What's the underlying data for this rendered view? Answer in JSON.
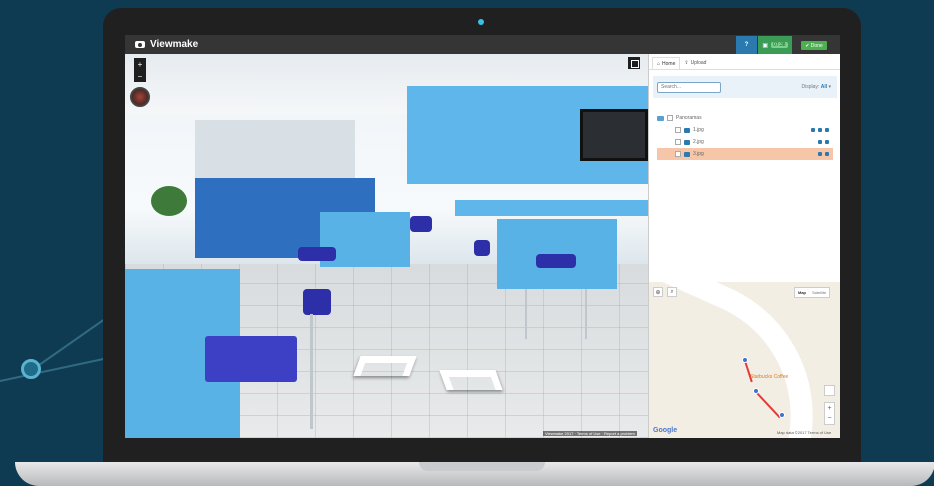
{
  "app": {
    "name": "Viewmake",
    "help_label": "?",
    "save_badge": "07:38",
    "done_label": "✔ Done"
  },
  "viewer": {
    "zoom_in": "+",
    "zoom_out": "−",
    "credit": "Viewmake 2017 · Terms of Use · Report a problem"
  },
  "panel": {
    "tabs": [
      {
        "label": "Home",
        "icon": "home-icon",
        "active": true
      },
      {
        "label": "Upload",
        "icon": "upload-icon",
        "active": false
      }
    ],
    "search": {
      "placeholder": "Search..."
    },
    "display": {
      "label": "Display:",
      "value": "All"
    },
    "tree": {
      "root": "Panoramas",
      "items": [
        {
          "label": "1.jpg",
          "selected": false
        },
        {
          "label": "2.jpg",
          "selected": false
        },
        {
          "label": "3.jpg",
          "selected": true
        }
      ]
    }
  },
  "map": {
    "type_map": "Map",
    "type_satellite": "Satellite",
    "poi": "Starbucks Coffee",
    "google": "Google",
    "footer": "Map data ©2017   Terms of Use",
    "zoom_in": "+",
    "zoom_out": "−"
  },
  "colors": {
    "background": "#0f3b52",
    "header": "#353535",
    "help": "#2a7ab0",
    "save": "#3a9c55",
    "done": "#4caf50",
    "selected_row": "#f7c6a8",
    "route": "#e53935"
  }
}
